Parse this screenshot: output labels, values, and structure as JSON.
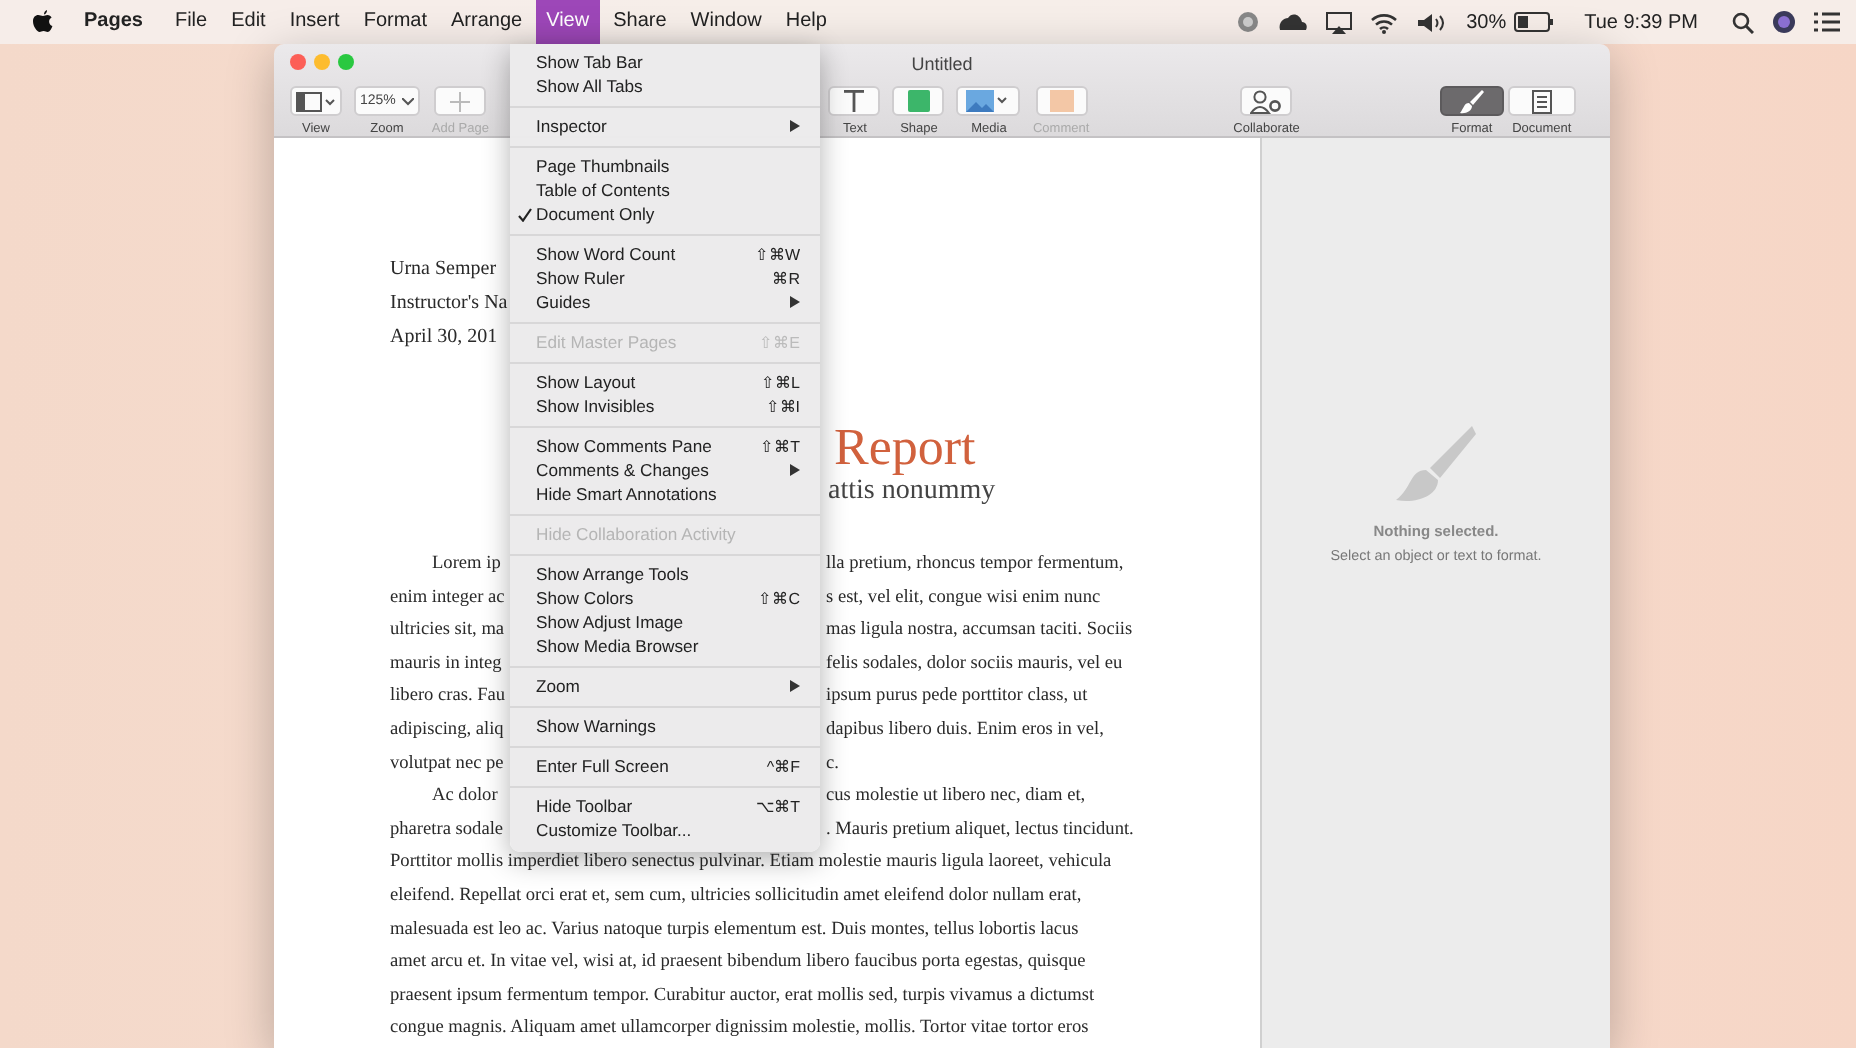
{
  "menu_bar": {
    "items": [
      {
        "label": "Pages",
        "kind": "app",
        "selected": false
      },
      {
        "label": "File",
        "kind": "menu",
        "selected": false
      },
      {
        "label": "Edit",
        "kind": "menu",
        "selected": false
      },
      {
        "label": "Insert",
        "kind": "menu",
        "selected": false
      },
      {
        "label": "Format",
        "kind": "menu",
        "selected": false
      },
      {
        "label": "Arrange",
        "kind": "menu",
        "selected": false
      },
      {
        "label": "View",
        "kind": "menu",
        "selected": true
      },
      {
        "label": "Share",
        "kind": "menu",
        "selected": false
      },
      {
        "label": "Window",
        "kind": "menu",
        "selected": false
      },
      {
        "label": "Help",
        "kind": "menu",
        "selected": false
      }
    ],
    "battery": "30%",
    "clock": "Tue 9:39 PM"
  },
  "window": {
    "title": "Untitled",
    "toolbar": {
      "left": [
        {
          "kind": "view",
          "label": "View",
          "disabled": false,
          "selected": false
        },
        {
          "kind": "zoom",
          "label": "Zoom",
          "value": "125%",
          "disabled": false,
          "selected": false
        },
        {
          "kind": "add_page",
          "label": "Add Page",
          "disabled": true,
          "selected": false
        }
      ],
      "middle": [
        {
          "kind": "text",
          "label": "Text",
          "disabled": false,
          "selected": false
        },
        {
          "kind": "shape",
          "label": "Shape",
          "disabled": false,
          "selected": false
        },
        {
          "kind": "media",
          "label": "Media",
          "disabled": false,
          "selected": false
        },
        {
          "kind": "comment",
          "label": "Comment",
          "disabled": true,
          "selected": false
        }
      ],
      "center": [
        {
          "kind": "collaborate",
          "label": "Collaborate",
          "disabled": false,
          "selected": false
        }
      ],
      "right": [
        {
          "kind": "format",
          "label": "Format",
          "disabled": false,
          "selected": true
        },
        {
          "kind": "document",
          "label": "Document",
          "disabled": false,
          "selected": false
        }
      ]
    },
    "document": {
      "header": [
        "Urna Semper",
        "Instructor's Na",
        "April 30, 201"
      ],
      "title": "Report",
      "subtitle": "attis nonummy",
      "lines": [
        {
          "left": "Lorem ip",
          "right": "lla pretium, rhoncus tempor fermentum,",
          "indent": true
        },
        {
          "left": "enim integer ac",
          "right": "s est, vel elit, congue wisi enim nunc",
          "indent": false
        },
        {
          "left": "ultricies sit, ma",
          "right": "mas ligula nostra, accumsan taciti. Sociis",
          "indent": false
        },
        {
          "left": "mauris in integ",
          "right": "felis sodales, dolor sociis mauris, vel eu",
          "indent": false
        },
        {
          "left": "libero cras. Fau",
          "right": "ipsum purus pede porttitor class, ut",
          "indent": false
        },
        {
          "left": "adipiscing, aliq",
          "right": "dapibus libero duis. Enim eros in vel,",
          "indent": false
        },
        {
          "left": "volutpat nec pe",
          "right": "c.",
          "indent": false
        },
        {
          "left": "Ac dolor",
          "right": "cus molestie ut libero nec, diam et,",
          "indent": true
        },
        {
          "left": "pharetra sodale",
          "right": ". Mauris pretium aliquet, lectus tincidunt.",
          "indent": false
        },
        {
          "text": "Porttitor mollis imperdiet libero senectus pulvinar. Etiam molestie mauris ligula laoreet, vehicula"
        },
        {
          "text": "eleifend. Repellat orci erat et, sem cum, ultricies sollicitudin amet eleifend dolor nullam erat,"
        },
        {
          "text": "malesuada est leo ac. Varius natoque turpis elementum est. Duis montes, tellus lobortis lacus"
        },
        {
          "text": "amet arcu et. In vitae vel, wisi at, id praesent bibendum libero faucibus porta egestas, quisque"
        },
        {
          "text": "praesent ipsum fermentum tempor. Curabitur auctor, erat mollis sed, turpis vivamus a dictumst"
        },
        {
          "text": "congue magnis. Aliquam amet ullamcorper dignissim molestie, mollis. Tortor vitae tortor eros"
        }
      ]
    },
    "inspector": {
      "heading": "Nothing selected.",
      "hint": "Select an object or text to format."
    }
  },
  "view_menu": {
    "groups": [
      {
        "items": [
          {
            "label": "Show Tab Bar",
            "checked": false,
            "disabled": false,
            "submenu": false
          },
          {
            "label": "Show All Tabs",
            "checked": false,
            "disabled": false,
            "submenu": false
          }
        ]
      },
      {
        "items": [
          {
            "label": "Inspector",
            "checked": false,
            "disabled": false,
            "submenu": true
          }
        ]
      },
      {
        "items": [
          {
            "label": "Page Thumbnails",
            "checked": false,
            "disabled": false,
            "submenu": false
          },
          {
            "label": "Table of Contents",
            "checked": false,
            "disabled": false,
            "submenu": false
          },
          {
            "label": "Document Only",
            "checked": true,
            "disabled": false,
            "submenu": false
          }
        ]
      },
      {
        "items": [
          {
            "label": "Show Word Count",
            "shortcut": "⇧⌘W",
            "checked": false,
            "disabled": false,
            "submenu": false
          },
          {
            "label": "Show Ruler",
            "shortcut": "⌘R",
            "checked": false,
            "disabled": false,
            "submenu": false
          },
          {
            "label": "Guides",
            "checked": false,
            "disabled": false,
            "submenu": true
          }
        ]
      },
      {
        "items": [
          {
            "label": "Edit Master Pages",
            "shortcut": "⇧⌘E",
            "checked": false,
            "disabled": true,
            "submenu": false
          }
        ]
      },
      {
        "items": [
          {
            "label": "Show Layout",
            "shortcut": "⇧⌘L",
            "checked": false,
            "disabled": false,
            "submenu": false
          },
          {
            "label": "Show Invisibles",
            "shortcut": "⇧⌘I",
            "checked": false,
            "disabled": false,
            "submenu": false
          }
        ]
      },
      {
        "items": [
          {
            "label": "Show Comments Pane",
            "shortcut": "⇧⌘T",
            "checked": false,
            "disabled": false,
            "submenu": false
          },
          {
            "label": "Comments & Changes",
            "checked": false,
            "disabled": false,
            "submenu": true
          },
          {
            "label": "Hide Smart Annotations",
            "checked": false,
            "disabled": false,
            "submenu": false
          }
        ]
      },
      {
        "items": [
          {
            "label": "Hide Collaboration Activity",
            "checked": false,
            "disabled": true,
            "submenu": false
          }
        ]
      },
      {
        "items": [
          {
            "label": "Show Arrange Tools",
            "checked": false,
            "disabled": false,
            "submenu": false
          },
          {
            "label": "Show Colors",
            "shortcut": "⇧⌘C",
            "checked": false,
            "disabled": false,
            "submenu": false
          },
          {
            "label": "Show Adjust Image",
            "checked": false,
            "disabled": false,
            "submenu": false
          },
          {
            "label": "Show Media Browser",
            "checked": false,
            "disabled": false,
            "submenu": false
          }
        ]
      },
      {
        "items": [
          {
            "label": "Zoom",
            "checked": false,
            "disabled": false,
            "submenu": true
          }
        ]
      },
      {
        "items": [
          {
            "label": "Show Warnings",
            "checked": false,
            "disabled": false,
            "submenu": false
          }
        ]
      },
      {
        "items": [
          {
            "label": "Enter Full Screen",
            "shortcut": "^⌘F",
            "checked": false,
            "disabled": false,
            "submenu": false
          }
        ]
      },
      {
        "items": [
          {
            "label": "Hide Toolbar",
            "shortcut": "⌥⌘T",
            "checked": false,
            "disabled": false,
            "submenu": false
          },
          {
            "label": "Customize Toolbar...",
            "checked": false,
            "disabled": false,
            "submenu": false
          }
        ]
      }
    ]
  }
}
